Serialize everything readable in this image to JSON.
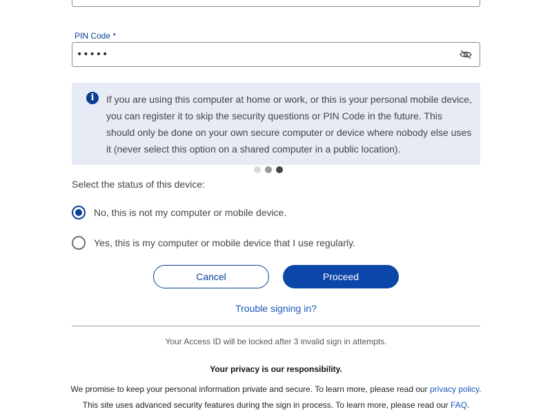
{
  "pin": {
    "label": "PIN Code *",
    "value": "•••••",
    "toggle_icon": "eye-slash-icon"
  },
  "info": {
    "icon": "info-icon",
    "icon_glyph": "i",
    "text": "If you are using this computer at home or work, or this is your personal mobile device, you can register it to skip the security questions or PIN Code in the future. This should only be done on your own secure computer or device where nobody else uses it (never select this option on a shared computer in a public location)."
  },
  "progress_dots": {
    "total": 3,
    "current": 3,
    "colors": [
      "#d9d9d9",
      "#9a9a9a",
      "#444444"
    ]
  },
  "device_status": {
    "prompt": "Select the status of this device:",
    "options": [
      {
        "label": "No, this is not my computer or mobile device.",
        "checked": true
      },
      {
        "label": "Yes, this is my computer or mobile device that I use regularly.",
        "checked": false
      }
    ]
  },
  "buttons": {
    "cancel": "Cancel",
    "proceed": "Proceed"
  },
  "trouble_link": "Trouble signing in?",
  "lock_note": "Your Access ID will be locked after 3 invalid sign in attempts.",
  "footer": {
    "privacy_title": "Your privacy is our responsibility.",
    "line1_text": "We promise to keep your personal information private and secure. To learn more, please read our ",
    "line1_link": "privacy policy",
    "line1_end": ".",
    "line2_text": "This site uses advanced security features during the sign in process. To learn more, please read our ",
    "line2_link": "FAQ",
    "line2_end": "."
  },
  "colors": {
    "brand": "#0b3d91",
    "primary_button": "#0b47a8",
    "link": "#1a56b8",
    "info_background": "#e6ebf5"
  }
}
